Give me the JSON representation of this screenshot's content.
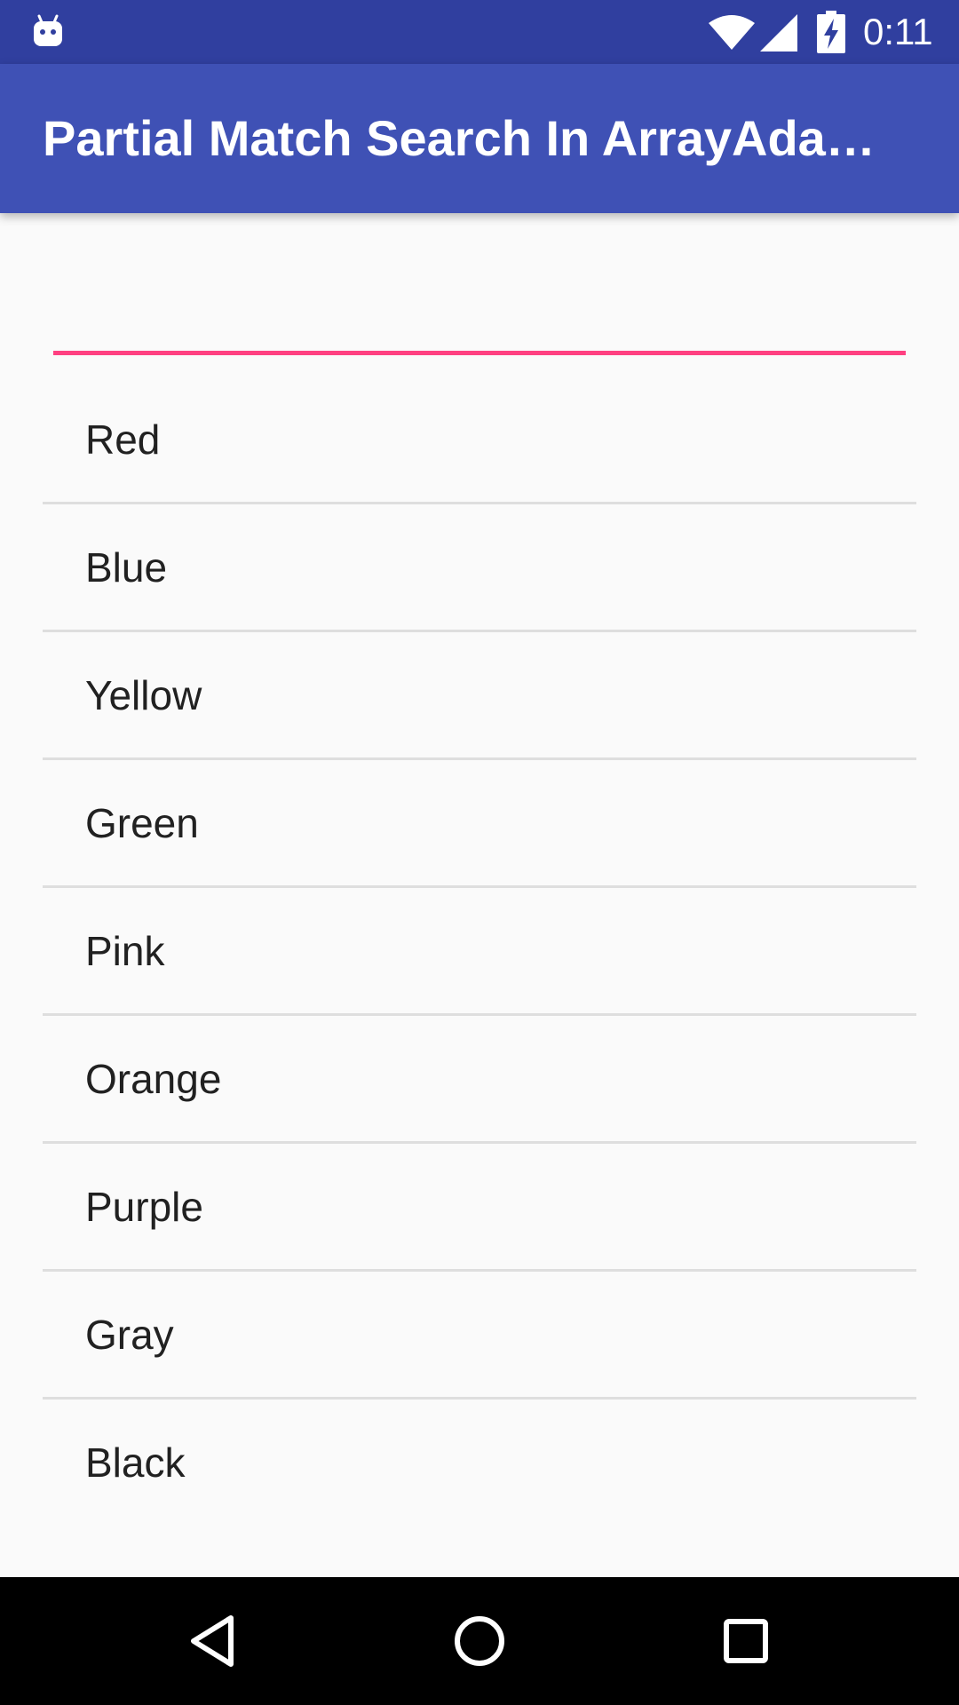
{
  "status_bar": {
    "time": "0:11",
    "icons": [
      "android-notification-icon",
      "wifi-icon",
      "signal-icon",
      "battery-charging-icon"
    ]
  },
  "app_bar": {
    "title": "Partial Match Search In ArrayAda…",
    "color": "#3f51b5"
  },
  "search": {
    "value": "",
    "placeholder": "",
    "underline_color": "#ff4081"
  },
  "list": {
    "items": [
      "Red",
      "Blue",
      "Yellow",
      "Green",
      "Pink",
      "Orange",
      "Purple",
      "Gray",
      "Black"
    ]
  },
  "nav_bar": {
    "buttons": [
      "back-icon",
      "home-icon",
      "recents-icon"
    ]
  },
  "colors": {
    "status_bar": "#303f9f",
    "app_bar": "#3f51b5",
    "accent": "#ff4081",
    "background": "#fafafa"
  }
}
